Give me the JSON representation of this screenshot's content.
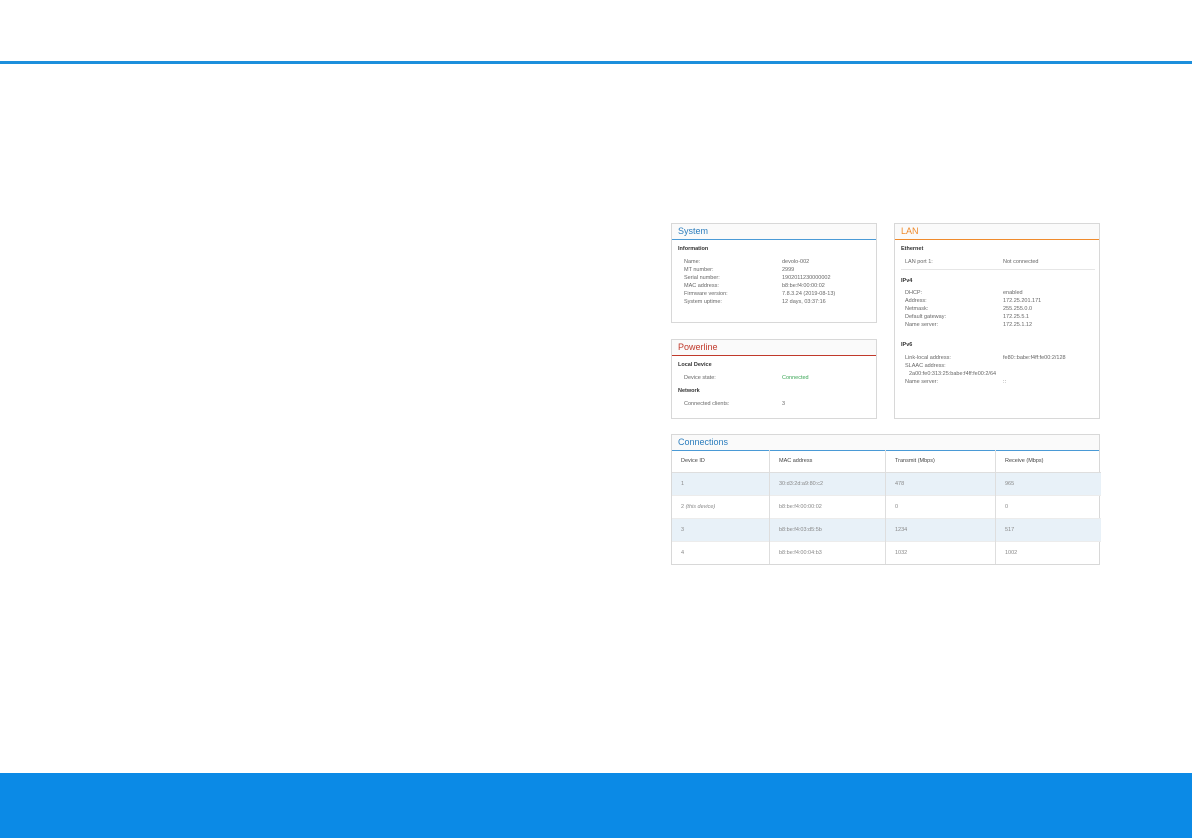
{
  "system": {
    "title": "System",
    "section": "Information",
    "rows": [
      {
        "label": "Name:",
        "value": "devolo-002"
      },
      {
        "label": "MT number:",
        "value": "2999"
      },
      {
        "label": "Serial number:",
        "value": "1902011230000002"
      },
      {
        "label": "MAC address:",
        "value": "b8:be:f4:00:00:02"
      },
      {
        "label": "Firmware version:",
        "value": "7.8.3.24 (2019-08-13)"
      },
      {
        "label": "System uptime:",
        "value": "12 days, 03:37:16"
      }
    ]
  },
  "powerline": {
    "title": "Powerline",
    "local_section": "Local Device",
    "device_state_label": "Device state:",
    "device_state_value": "Connected",
    "network_section": "Network",
    "clients_label": "Connected clients:",
    "clients_value": "3"
  },
  "lan": {
    "title": "LAN",
    "ethernet_section": "Ethernet",
    "lan_port_label": "LAN port 1:",
    "lan_port_value": "Not connected",
    "ipv4_section": "IPv4",
    "ipv4_rows": [
      {
        "label": "DHCP:",
        "value": "enabled"
      },
      {
        "label": "Address:",
        "value": "172.25.201.171"
      },
      {
        "label": "Netmask:",
        "value": "255.255.0.0"
      },
      {
        "label": "Default gateway:",
        "value": "172.25.5.1"
      },
      {
        "label": "Name server:",
        "value": "172.25.1.12"
      }
    ],
    "ipv6_section": "IPv6",
    "link_local_label": "Link-local address:",
    "link_local_value": "fe80::babe:f4ff:fe00:2/128",
    "slaac_label": "SLAAC address:",
    "slaac_value": "2a00:fe0:313:25:babe:f4ff:fe00:2/64",
    "ns6_label": "Name server:",
    "ns6_value": "::"
  },
  "connections": {
    "title": "Connections",
    "headers": [
      "Device ID",
      "MAC address",
      "Transmit (Mbps)",
      "Receive (Mbps)"
    ],
    "rows": [
      {
        "id": "1",
        "note": "",
        "mac": "30:d3:2d:a9:80:c2",
        "tx": "478",
        "rx": "965"
      },
      {
        "id": "2",
        "note": "(this device)",
        "mac": "b8:be:f4:00:00:02",
        "tx": "0",
        "rx": "0"
      },
      {
        "id": "3",
        "note": "",
        "mac": "b8:be:f4:03:d5:5b",
        "tx": "1234",
        "rx": "517"
      },
      {
        "id": "4",
        "note": "",
        "mac": "b8:be:f4:00:04:b3",
        "tx": "1032",
        "rx": "1002"
      }
    ]
  },
  "colors": {
    "accent_blue": "#1d8fdc",
    "footer_blue": "#0b8ae6",
    "lan_orange": "#ef8a2c",
    "powerline_red": "#c0392b",
    "connected_green": "#3aa655"
  }
}
